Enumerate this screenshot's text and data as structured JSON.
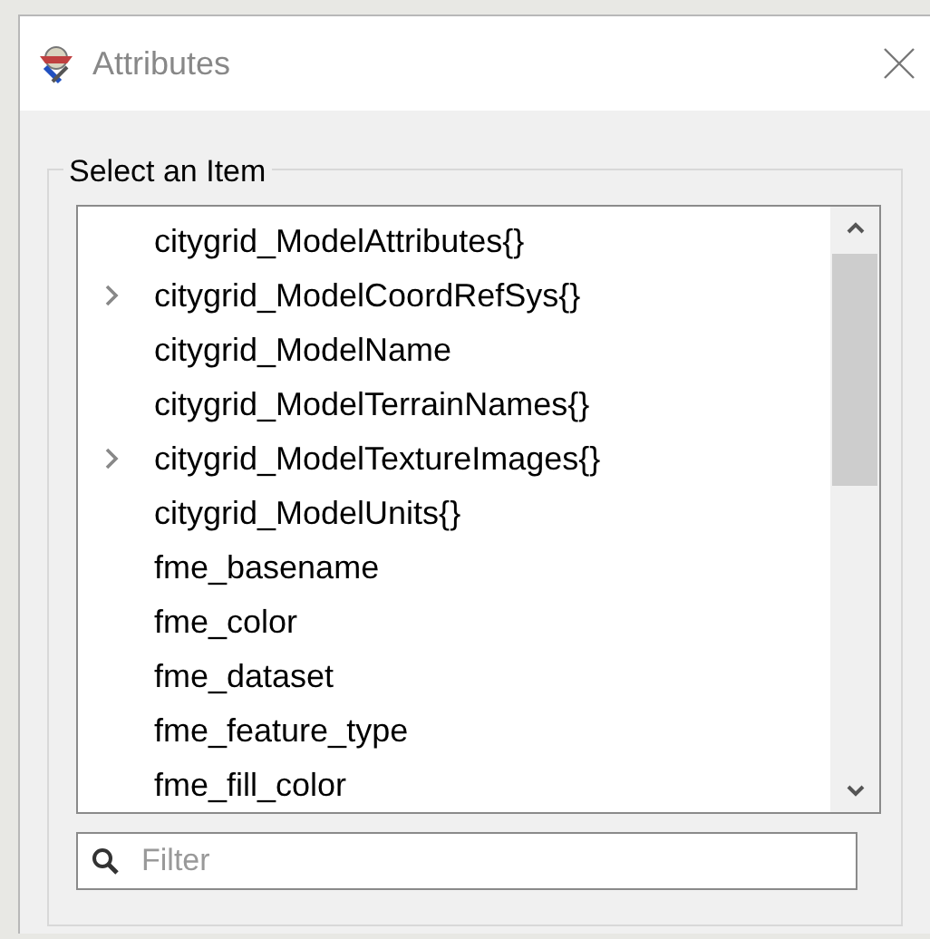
{
  "window": {
    "title": "Attributes"
  },
  "group": {
    "label": "Select an Item"
  },
  "items": [
    {
      "label": "citygrid_ModelAttributes{}",
      "expandable": false
    },
    {
      "label": "citygrid_ModelCoordRefSys{}",
      "expandable": true
    },
    {
      "label": "citygrid_ModelName",
      "expandable": false
    },
    {
      "label": "citygrid_ModelTerrainNames{}",
      "expandable": false
    },
    {
      "label": "citygrid_ModelTextureImages{}",
      "expandable": true
    },
    {
      "label": "citygrid_ModelUnits{}",
      "expandable": false
    },
    {
      "label": "fme_basename",
      "expandable": false
    },
    {
      "label": "fme_color",
      "expandable": false
    },
    {
      "label": "fme_dataset",
      "expandable": false
    },
    {
      "label": "fme_feature_type",
      "expandable": false
    },
    {
      "label": "fme_fill_color",
      "expandable": false
    }
  ],
  "filter": {
    "placeholder": "Filter"
  }
}
